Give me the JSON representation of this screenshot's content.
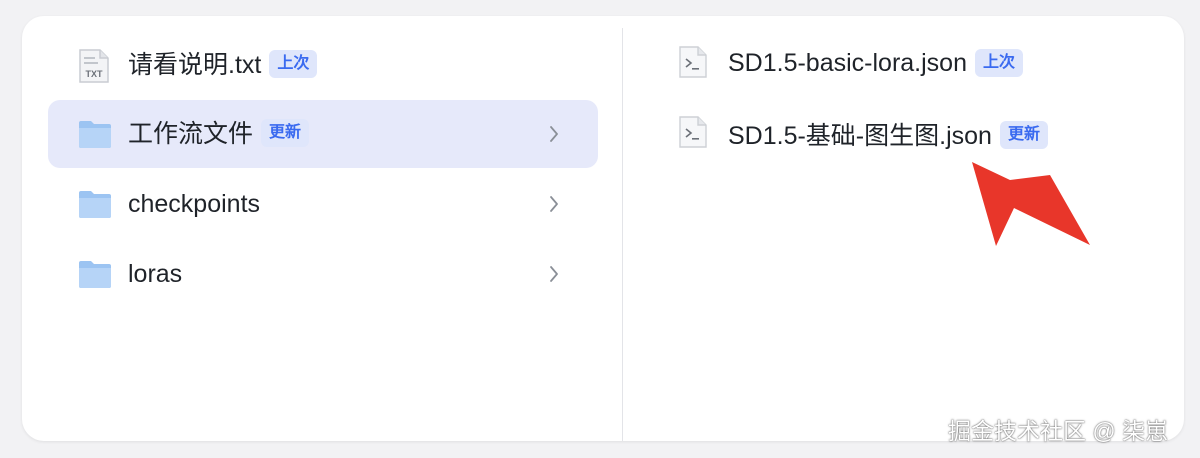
{
  "left_pane": {
    "items": [
      {
        "label": "请看说明.txt",
        "badge": "上次",
        "icon": "txt-file-icon"
      },
      {
        "label": "工作流文件",
        "badge": "更新",
        "icon": "folder-icon",
        "selected": true
      },
      {
        "label": "checkpoints",
        "icon": "folder-icon"
      },
      {
        "label": "loras",
        "icon": "folder-icon"
      }
    ]
  },
  "right_pane": {
    "items": [
      {
        "label": "SD1.5-basic-lora.json",
        "badge": "上次",
        "icon": "terminal-file-icon"
      },
      {
        "label": "SD1.5-基础-图生图.json",
        "badge": "更新",
        "icon": "terminal-file-icon"
      }
    ]
  },
  "annotation": {
    "icon": "red-arrow-icon",
    "color": "#e8362a"
  },
  "watermark": "掘金技术社区 @ 柒崽",
  "colors": {
    "badge_text": "#3a6af0",
    "badge_bg": "#dfe6fb",
    "selected_row": "#e6e9fa",
    "folder": "#8fbcf0"
  }
}
